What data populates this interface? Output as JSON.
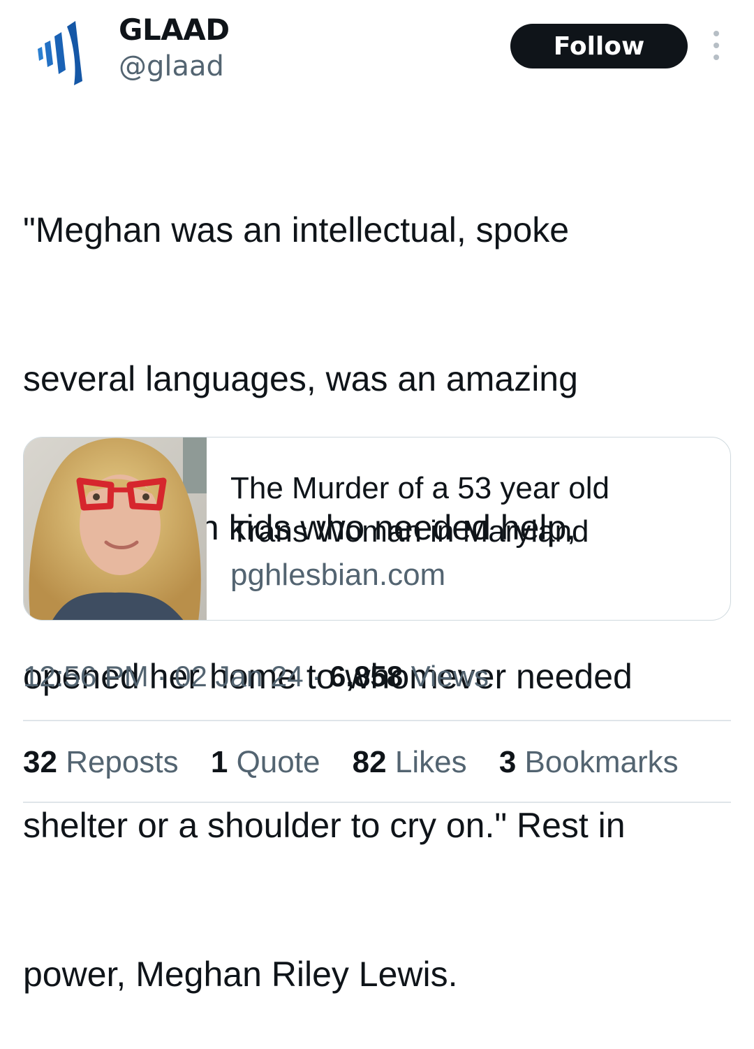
{
  "author": {
    "name": "GLAAD",
    "handle": "@glaad",
    "logo_icon": "glaad-signal-logo-icon",
    "logo_color": "#1a5fa8"
  },
  "follow_button": {
    "label": "Follow",
    "color": "#0f1419"
  },
  "more_icon": "more-options-icon",
  "tweet": {
    "text_lines": [
      "\"Meghan was an intellectual, spoke",
      "several languages, was an amazing",
      "cook, took in kids who needed help,",
      "opened her home to whomever needed",
      "shelter or a shoulder to cry on.\" Rest in",
      "power, Meghan Riley Lewis."
    ]
  },
  "link_card": {
    "title_lines": [
      "The Murder of a 53 year old",
      "Trans Woman in Maryland"
    ],
    "domain": "pghlesbian.com",
    "thumbnail": "portrait-photo-woman-curly-blonde-hair-red-glasses"
  },
  "meta": {
    "time": "12:56 PM",
    "separator": "·",
    "date": "02 Jan 24",
    "views_count": "6,858",
    "views_label": "Views"
  },
  "stats": {
    "reposts_count": "32",
    "reposts_label": "Reposts",
    "quotes_count": "1",
    "quotes_label": "Quote",
    "likes_count": "82",
    "likes_label": "Likes",
    "bookmarks_count": "3",
    "bookmarks_label": "Bookmarks"
  }
}
